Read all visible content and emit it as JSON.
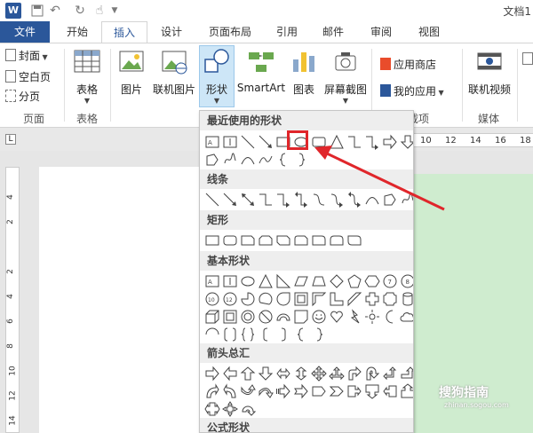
{
  "title_bar": {
    "app_icon": "W",
    "undo_icon": "↶",
    "redo_icon": "↻",
    "touch_icon": "☝",
    "doc_title": "文档1"
  },
  "tabs": {
    "file": "文件",
    "items": [
      "开始",
      "插入",
      "设计",
      "页面布局",
      "引用",
      "邮件",
      "审阅",
      "视图"
    ],
    "active": "插入"
  },
  "ribbon": {
    "pages_group": {
      "cover": "封面",
      "blank": "空白页",
      "break": "分页",
      "label": "页面"
    },
    "table_group": {
      "table": "表格",
      "label": "表格"
    },
    "illustrations": {
      "picture": "图片",
      "online_picture": "联机图片",
      "shapes": "形状",
      "smartart": "SmartArt",
      "chart": "图表",
      "screenshot": "屏幕截图"
    },
    "apps_group": {
      "store": "应用商店",
      "my_apps": "我的应用",
      "label": "加载项"
    },
    "media_group": {
      "online_video": "联机视频",
      "label": "媒体"
    }
  },
  "ruler": {
    "corner": "L",
    "numbers": [
      "10",
      "12",
      "14",
      "16",
      "18"
    ],
    "vertical_numbers": [
      "4",
      "2",
      "2",
      "4",
      "6",
      "8",
      "10",
      "12",
      "14"
    ]
  },
  "shapes_menu": {
    "recent": "最近使用的形状",
    "lines": "线条",
    "rectangles": "矩形",
    "basic": "基本形状",
    "arrows": "箭头总汇",
    "equation": "公式形状"
  },
  "watermark": {
    "brand": "搜狗指南",
    "url": "zhinan.sogou.com"
  },
  "colors": {
    "accent": "#2b579a",
    "highlight": "#e0262b",
    "doc_bg": "#cfeccf"
  }
}
